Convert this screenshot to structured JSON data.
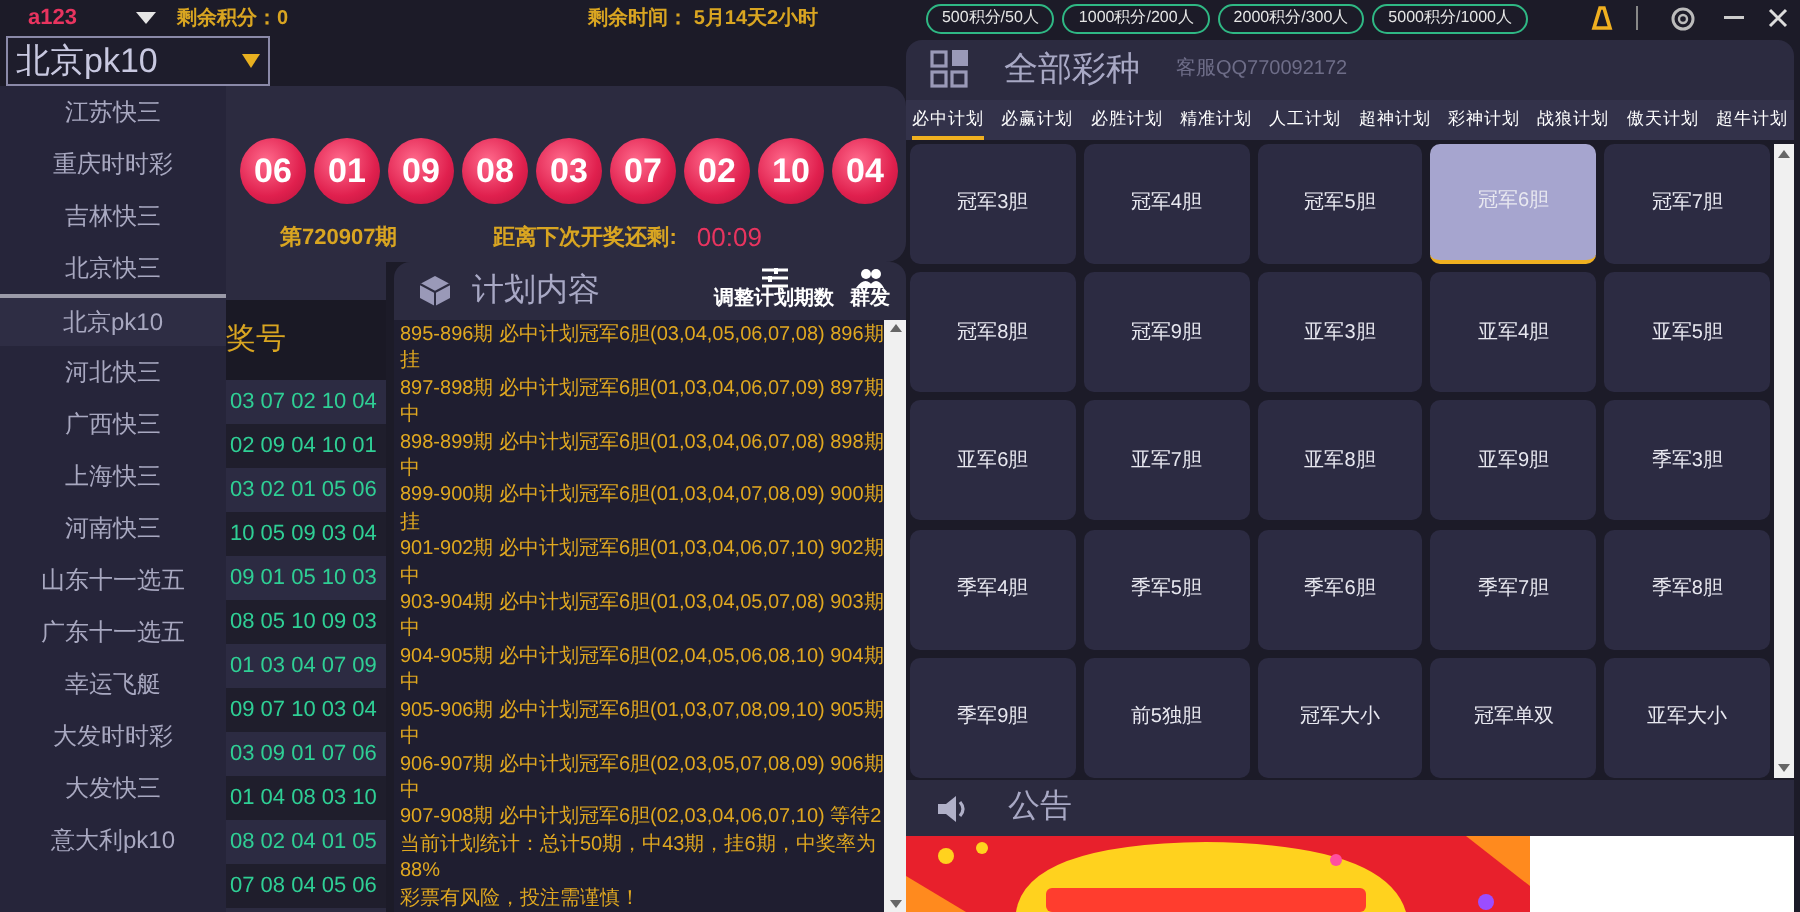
{
  "top_bar": {
    "user": "a123",
    "points": "剩余积分：0",
    "time_left": "剩余时间： 5月14天2小时",
    "packages": [
      "500积分/50人",
      "1000积分/200人",
      "2000积分/300人",
      "5000积分/1000人"
    ]
  },
  "selector": {
    "value": "北京pk10"
  },
  "menu": [
    {
      "label": "江苏快三",
      "selected": false
    },
    {
      "label": "重庆时时彩",
      "selected": false
    },
    {
      "label": "吉林快三",
      "selected": false
    },
    {
      "label": "北京快三",
      "selected": false
    },
    {
      "label": "北京pk10",
      "selected": true
    },
    {
      "label": "河北快三",
      "selected": false
    },
    {
      "label": "广西快三",
      "selected": false
    },
    {
      "label": "上海快三",
      "selected": false
    },
    {
      "label": "河南快三",
      "selected": false
    },
    {
      "label": "山东十一选五",
      "selected": false
    },
    {
      "label": "广东十一选五",
      "selected": false
    },
    {
      "label": "幸运飞艇",
      "selected": false
    },
    {
      "label": "大发时时彩",
      "selected": false
    },
    {
      "label": "大发快三",
      "selected": false
    },
    {
      "label": "意大利pk10",
      "selected": false
    }
  ],
  "draw": {
    "balls": [
      "06",
      "01",
      "09",
      "08",
      "03",
      "07",
      "02",
      "10",
      "04"
    ],
    "period": "第720907期",
    "countdown_label": "距离下次开奖还剩:",
    "countdown": "00:09"
  },
  "history": {
    "header": "奖号",
    "rows": [
      "03 07 02 10 04",
      "02 09 04 10 01",
      "03 02 01 05 06",
      "10 05 09 03 04",
      "09 01 05 10 03",
      "08 05 10 09 03",
      "01 03 04 07 09",
      "09 07 10 03 04",
      "03 09 01 07 06",
      "01 04 08 03 10",
      "08 02 04 01 05",
      "07 08 04 05 06"
    ]
  },
  "plan": {
    "title": "计划内容",
    "adjust": "调整计划期数",
    "broadcast": "群发",
    "lines": [
      "895-896期 必中计划冠军6胆(03,04,05,06,07,08) 896期挂",
      "897-898期 必中计划冠军6胆(01,03,04,06,07,09) 897期中",
      "898-899期 必中计划冠军6胆(01,03,04,06,07,08) 898期中",
      "899-900期 必中计划冠军6胆(01,03,04,07,08,09) 900期挂",
      "901-902期 必中计划冠军6胆(01,03,04,06,07,10) 902期中",
      "903-904期 必中计划冠军6胆(01,03,04,05,07,08) 903期中",
      "904-905期 必中计划冠军6胆(02,04,05,06,08,10) 904期中",
      "905-906期 必中计划冠军6胆(01,03,07,08,09,10) 905期中",
      "906-907期 必中计划冠军6胆(02,03,05,07,08,09) 906期中",
      "907-908期 必中计划冠军6胆(02,03,04,06,07,10) 等待2",
      "当前计划统计：总计50期，中43期，挂6期，中奖率为88%",
      "彩票有风险，投注需谨慎！"
    ]
  },
  "lottery": {
    "title": "全部彩种",
    "service": "客服QQ770092172",
    "tabs": [
      {
        "label": "必中计划",
        "selected": true
      },
      {
        "label": "必赢计划",
        "selected": false
      },
      {
        "label": "必胜计划",
        "selected": false
      },
      {
        "label": "精准计划",
        "selected": false
      },
      {
        "label": "人工计划",
        "selected": false
      },
      {
        "label": "超神计划",
        "selected": false
      },
      {
        "label": "彩神计划",
        "selected": false
      },
      {
        "label": "战狼计划",
        "selected": false
      },
      {
        "label": "傲天计划",
        "selected": false
      },
      {
        "label": "超牛计划",
        "selected": false
      }
    ],
    "items": [
      {
        "label": "冠军3胆",
        "selected": false
      },
      {
        "label": "冠军4胆",
        "selected": false
      },
      {
        "label": "冠军5胆",
        "selected": false
      },
      {
        "label": "冠军6胆",
        "selected": true
      },
      {
        "label": "冠军7胆",
        "selected": false
      },
      {
        "label": "冠军8胆",
        "selected": false
      },
      {
        "label": "冠军9胆",
        "selected": false
      },
      {
        "label": "亚军3胆",
        "selected": false
      },
      {
        "label": "亚军4胆",
        "selected": false
      },
      {
        "label": "亚军5胆",
        "selected": false
      },
      {
        "label": "亚军6胆",
        "selected": false
      },
      {
        "label": "亚军7胆",
        "selected": false
      },
      {
        "label": "亚军8胆",
        "selected": false
      },
      {
        "label": "亚军9胆",
        "selected": false
      },
      {
        "label": "季军3胆",
        "selected": false
      },
      {
        "label": "季军4胆",
        "selected": false
      },
      {
        "label": "季军5胆",
        "selected": false
      },
      {
        "label": "季军6胆",
        "selected": false
      },
      {
        "label": "季军7胆",
        "selected": false
      },
      {
        "label": "季军8胆",
        "selected": false
      },
      {
        "label": "季军9胆",
        "selected": false
      },
      {
        "label": "前5独胆",
        "selected": false
      },
      {
        "label": "冠军大小",
        "selected": false
      },
      {
        "label": "冠军单双",
        "selected": false
      },
      {
        "label": "亚军大小",
        "selected": false
      }
    ]
  },
  "notice": {
    "title": "公告"
  }
}
